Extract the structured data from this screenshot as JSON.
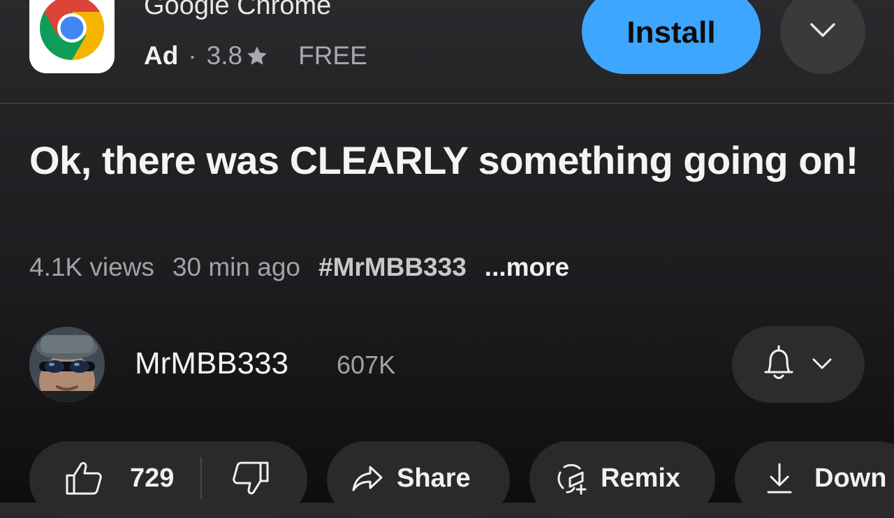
{
  "ad": {
    "app_name": "Google Chrome",
    "ad_label": "Ad",
    "separator": "·",
    "rating": "3.8",
    "price": "FREE",
    "install_label": "Install",
    "colors": {
      "install_bg": "#3ea6ff",
      "chrome_red": "#db4437",
      "chrome_yellow": "#f4b400",
      "chrome_green": "#0f9d58",
      "chrome_blue": "#4285f4"
    }
  },
  "video": {
    "title": "Ok, there was CLEARLY something going on!",
    "views": "4.1K views",
    "age": "30 min ago",
    "hashtag": "#MrMBB333",
    "more_label": "...more"
  },
  "channel": {
    "name": "MrMBB333",
    "subscribers": "607K"
  },
  "actions": {
    "like_count": "729",
    "share_label": "Share",
    "remix_label": "Remix",
    "download_label": "Down"
  },
  "icons": [
    "chrome-logo-icon",
    "star-icon",
    "chevron-down-icon",
    "bell-icon",
    "thumbs-up-icon",
    "thumbs-down-icon",
    "share-arrow-icon",
    "remix-icon",
    "download-icon"
  ]
}
